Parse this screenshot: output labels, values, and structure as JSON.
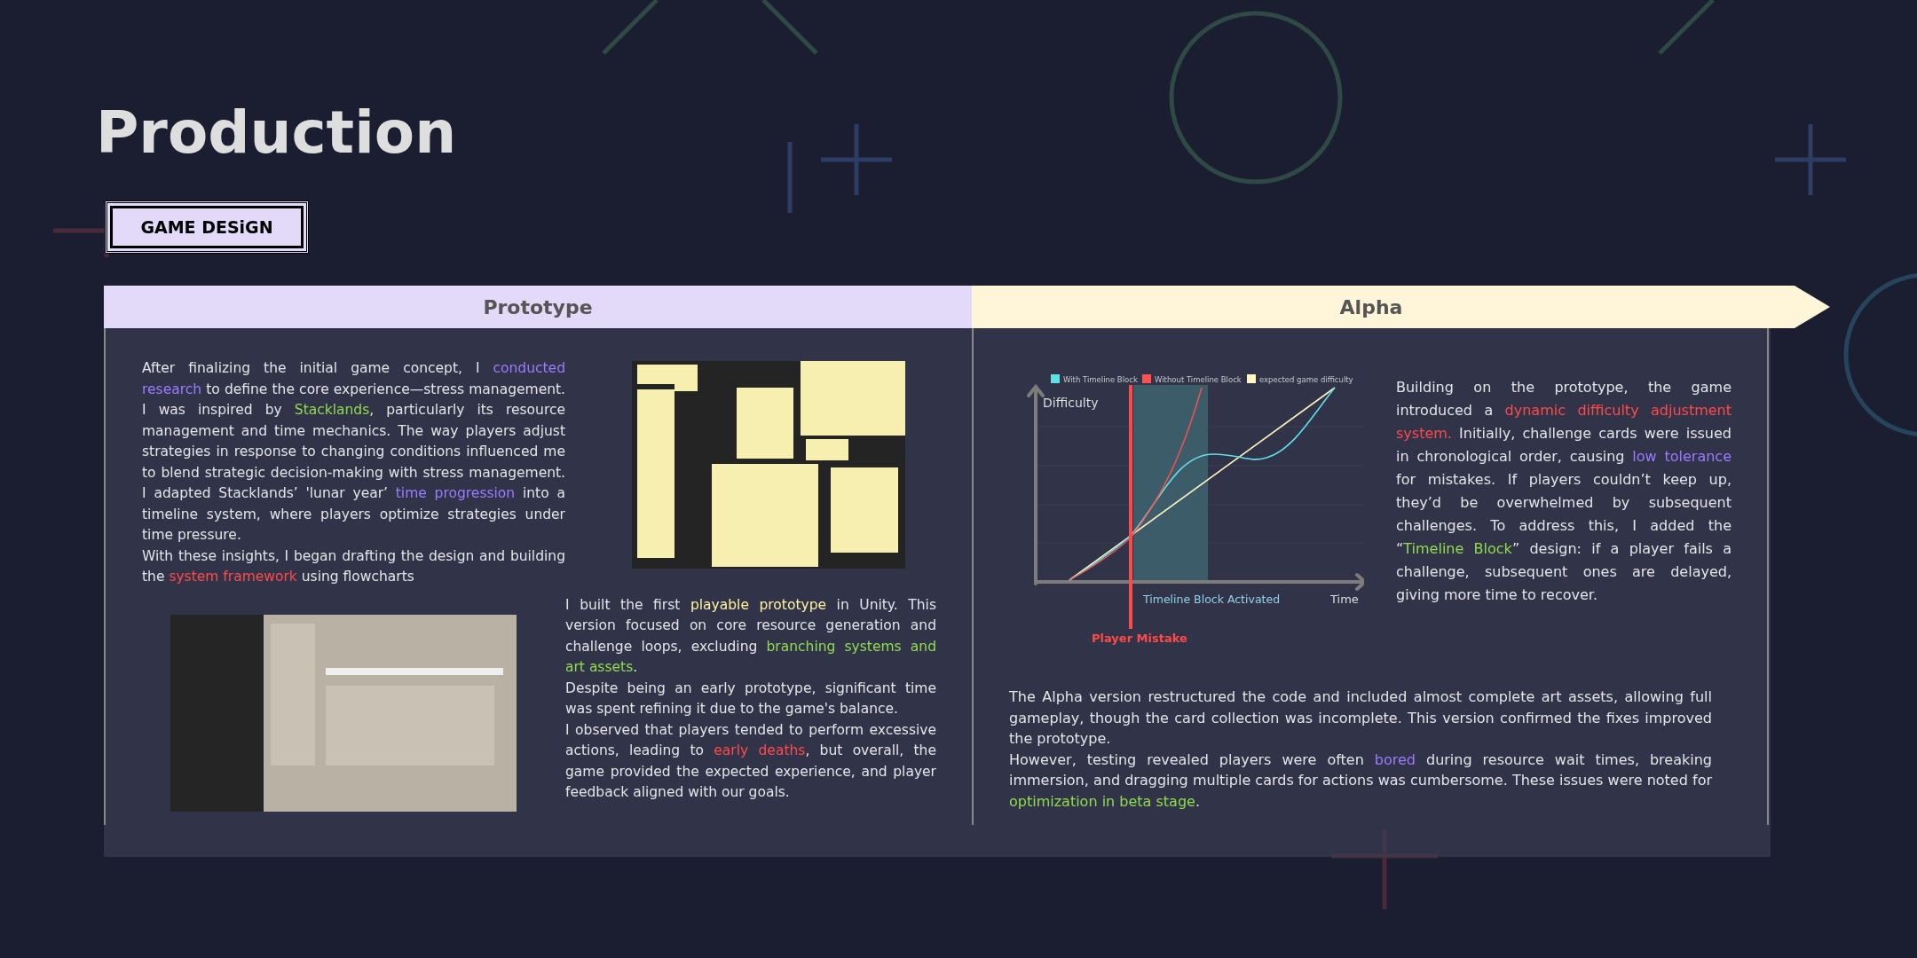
{
  "page_title": "Production",
  "section_label": "GAME DESiGN",
  "prototype": {
    "header": "Prototype",
    "intro": [
      [
        {
          "text": "After finalizing the initial game concept, I "
        },
        {
          "text": "conducted research",
          "color": "#9b7bff"
        },
        {
          "text": " to define the core experience—stress management. I was inspired by "
        },
        {
          "text": "Stacklands",
          "color": "#8fdc4e"
        },
        {
          "text": ", particularly its resource management and time mechanics. The way players adjust strategies in response to changing conditions influenced me to blend strategic decision-making with stress management. I adapted Stacklands’ 'lunar year’ "
        },
        {
          "text": "time progression",
          "color": "#9b7bff"
        },
        {
          "text": " into a timeline system, where players optimize strategies under time pressure."
        }
      ],
      [
        {
          "text": "With these insights, I began drafting the design and building the "
        },
        {
          "text": "system framework",
          "color": "#ff4a4a"
        },
        {
          "text": " using flowcharts"
        }
      ]
    ],
    "notes": [
      [
        {
          "text": "I built the first "
        },
        {
          "text": "playable prototype",
          "color": "#fff3a0"
        },
        {
          "text": " in Unity. This version focused on core resource generation and challenge loops, excluding "
        },
        {
          "text": "branching systems and art assets",
          "color": "#8fdc4e"
        },
        {
          "text": "."
        }
      ],
      [
        {
          "text": "Despite being an early prototype, significant time was spent refining it due to the game's balance."
        }
      ],
      [
        {
          "text": "I observed that players tended to perform excessive actions, leading to "
        },
        {
          "text": "early deaths",
          "color": "#ff4a4a"
        },
        {
          "text": ", but overall, the game provided the expected experience, and player feedback aligned with our goals."
        }
      ]
    ]
  },
  "alpha": {
    "header": "Alpha",
    "chart": {
      "legend": [
        {
          "label": "With Timeline Block",
          "color": "#5fe0e6"
        },
        {
          "label": "Without Timeline Block",
          "color": "#ff5050"
        },
        {
          "label": "expected game difficulty",
          "color": "#fff6c4"
        }
      ],
      "ylabel": "Difficulty",
      "xlabel": "Time",
      "region_label": "Timeline Block Activated",
      "marker_label": "Player Mistake"
    },
    "summary": [
      [
        {
          "text": "Building on the prototype, the game introduced a "
        },
        {
          "text": "dynamic difficulty adjustment system.",
          "color": "#ff4a4a"
        },
        {
          "text": " Initially, challenge cards were issued in chronological order, causing "
        },
        {
          "text": "low tolerance",
          "color": "#9b7bff"
        },
        {
          "text": " for mistakes. If players couldn’t keep up, they’d be overwhelmed by subsequent challenges. To address this, I added the “"
        },
        {
          "text": "Timeline Block",
          "color": "#8fdc4e"
        },
        {
          "text": "” design: if a player fails a challenge, subsequent ones are delayed, giving more time to recover."
        }
      ]
    ],
    "results": [
      [
        {
          "text": "The Alpha version restructured the code and included almost complete art assets, allowing full gameplay, though the card collection was incomplete. This version confirmed the fixes improved the prototype."
        }
      ],
      [
        {
          "text": "However, testing revealed players were often "
        },
        {
          "text": "bored",
          "color": "#9b7bff"
        },
        {
          "text": " during resource wait times, breaking immersion, and dragging multiple cards for actions was cumbersome. These issues were noted for "
        },
        {
          "text": "optimization in beta stage",
          "color": "#8fdc4e"
        },
        {
          "text": "."
        }
      ]
    ]
  }
}
